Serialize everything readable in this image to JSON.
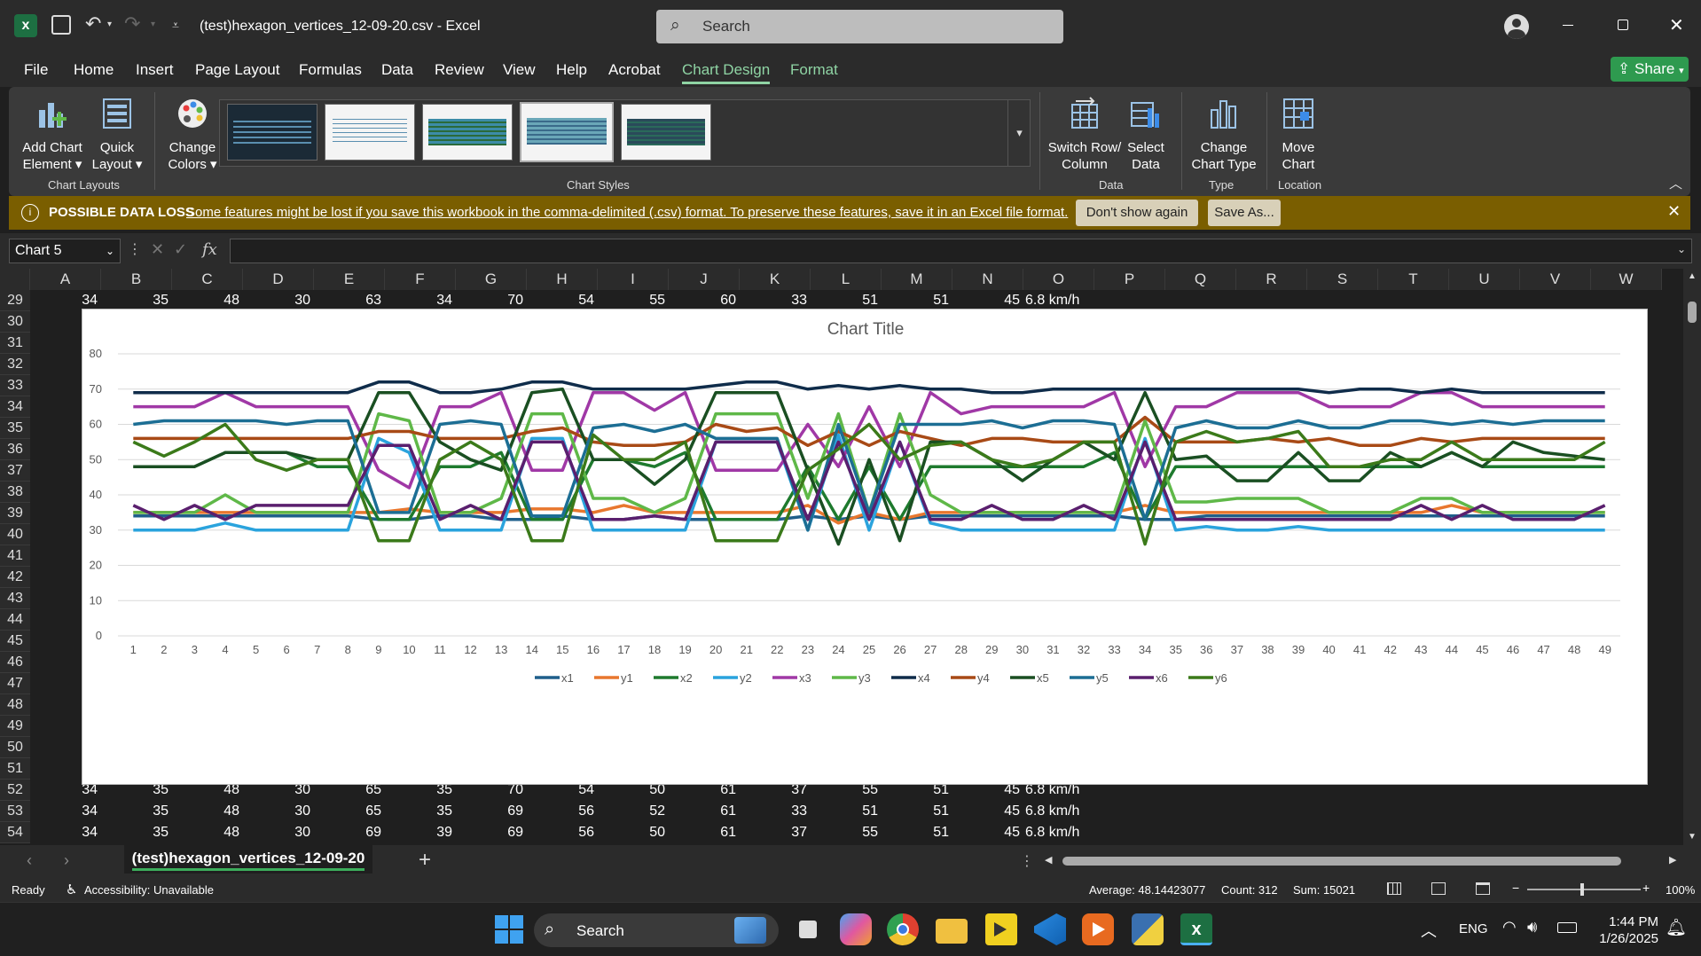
{
  "titlebar": {
    "filename": "(test)hexagon_vertices_12-09-20.csv",
    "app": "Excel",
    "separator": "-",
    "search_placeholder": "Search"
  },
  "menu": [
    "File",
    "Home",
    "Insert",
    "Page Layout",
    "Formulas",
    "Data",
    "Review",
    "View",
    "Help",
    "Acrobat",
    "Chart Design",
    "Format"
  ],
  "active_menu": "Chart Design",
  "share_label": "Share",
  "ribbon": {
    "add_chart_element": [
      "Add Chart",
      "Element"
    ],
    "quick_layout": [
      "Quick",
      "Layout"
    ],
    "change_colors": [
      "Change",
      "Colors"
    ],
    "switch_row_col": [
      "Switch Row/",
      "Column"
    ],
    "select_data": [
      "Select",
      "Data"
    ],
    "change_chart_type": [
      "Change",
      "Chart Type"
    ],
    "move_chart": [
      "Move",
      "Chart"
    ],
    "groups": {
      "chart_layouts": "Chart Layouts",
      "chart_styles": "Chart Styles",
      "data": "Data",
      "type": "Type",
      "location": "Location"
    }
  },
  "message_bar": {
    "title": "POSSIBLE DATA LOSS",
    "text": "Some features might be lost if you save this workbook in the comma-delimited (.csv) format. To preserve these features, save it in an Excel file format.",
    "dont_show": "Don't show again",
    "save_as": "Save As..."
  },
  "name_box": "Chart 5",
  "fx_label": "fx",
  "columns": [
    "A",
    "B",
    "C",
    "D",
    "E",
    "F",
    "G",
    "H",
    "I",
    "J",
    "K",
    "L",
    "M",
    "N",
    "O",
    "P",
    "Q",
    "R",
    "S",
    "T",
    "U",
    "V",
    "W"
  ],
  "rows": {
    "r29": {
      "num": "29",
      "cells": [
        "34",
        "35",
        "48",
        "30",
        "63",
        "34",
        "70",
        "54",
        "55",
        "60",
        "33",
        "51",
        "51",
        "45",
        "6.8 km/h"
      ]
    },
    "hidden_rows": [
      "30",
      "31",
      "32",
      "33",
      "34",
      "35",
      "36",
      "37",
      "38",
      "39",
      "40",
      "41",
      "42",
      "43",
      "44",
      "45",
      "46",
      "47",
      "48",
      "49",
      "50",
      "51"
    ],
    "r52": {
      "num": "52",
      "cells": [
        "34",
        "35",
        "48",
        "30",
        "65",
        "35",
        "70",
        "54",
        "50",
        "61",
        "37",
        "55",
        "51",
        "45",
        "6.8 km/h"
      ]
    },
    "r53": {
      "num": "53",
      "cells": [
        "34",
        "35",
        "48",
        "30",
        "65",
        "35",
        "69",
        "56",
        "52",
        "61",
        "33",
        "51",
        "51",
        "45",
        "6.8 km/h"
      ]
    },
    "r54": {
      "num": "54",
      "cells": [
        "34",
        "35",
        "48",
        "30",
        "69",
        "39",
        "69",
        "56",
        "50",
        "61",
        "37",
        "55",
        "51",
        "45",
        "6.8 km/h"
      ]
    }
  },
  "sheet_tab": "(test)hexagon_vertices_12-09-20",
  "status": {
    "ready": "Ready",
    "accessibility": "Accessibility: Unavailable",
    "average": "Average: 48.14423077",
    "count": "Count: 312",
    "sum": "Sum: 15021",
    "zoom": "100%"
  },
  "taskbar": {
    "search": "Search",
    "lang": "ENG",
    "time": "1:44 PM",
    "date": "1/26/2025"
  },
  "chart_data": {
    "type": "line",
    "title": "Chart Title",
    "ylim": [
      0,
      80
    ],
    "yticks": [
      0,
      10,
      20,
      30,
      40,
      50,
      60,
      70,
      80
    ],
    "x": [
      1,
      2,
      3,
      4,
      5,
      6,
      7,
      8,
      9,
      10,
      11,
      12,
      13,
      14,
      15,
      16,
      17,
      18,
      19,
      20,
      21,
      22,
      23,
      24,
      25,
      26,
      27,
      28,
      29,
      30,
      31,
      32,
      33,
      34,
      35,
      36,
      37,
      38,
      39,
      40,
      41,
      42,
      43,
      44,
      45,
      46,
      47,
      48,
      49
    ],
    "legend_position": "bottom",
    "series": [
      {
        "name": "x1",
        "color": "#1f5f8b",
        "values": [
          34,
          34,
          34,
          34,
          34,
          34,
          34,
          34,
          33,
          33,
          34,
          34,
          33,
          33,
          34,
          33,
          33,
          34,
          33,
          33,
          33,
          33,
          34,
          33,
          34,
          33,
          34,
          34,
          34,
          34,
          34,
          34,
          34,
          33,
          33,
          34,
          34,
          34,
          34,
          34,
          34,
          34,
          34,
          34,
          34,
          34,
          34,
          34,
          34
        ]
      },
      {
        "name": "y1",
        "color": "#e8772e",
        "values": [
          35,
          35,
          35,
          35,
          35,
          35,
          35,
          35,
          35,
          36,
          35,
          35,
          35,
          36,
          36,
          35,
          37,
          35,
          35,
          35,
          35,
          35,
          37,
          32,
          35,
          33,
          35,
          35,
          35,
          35,
          35,
          35,
          35,
          37,
          35,
          35,
          35,
          35,
          35,
          35,
          35,
          35,
          35,
          37,
          35,
          35,
          35,
          35,
          35
        ]
      },
      {
        "name": "x2",
        "color": "#1e7a2e",
        "values": [
          48,
          48,
          48,
          52,
          52,
          52,
          48,
          48,
          33,
          33,
          48,
          48,
          52,
          33,
          33,
          50,
          50,
          48,
          52,
          33,
          33,
          33,
          48,
          33,
          48,
          33,
          48,
          48,
          48,
          48,
          48,
          48,
          52,
          33,
          48,
          48,
          48,
          48,
          48,
          48,
          48,
          48,
          48,
          52,
          48,
          48,
          48,
          48,
          48
        ]
      },
      {
        "name": "y2",
        "color": "#2aa3dd",
        "values": [
          30,
          30,
          30,
          32,
          30,
          30,
          30,
          30,
          56,
          52,
          30,
          30,
          30,
          56,
          56,
          30,
          30,
          30,
          30,
          55,
          55,
          55,
          30,
          57,
          30,
          55,
          32,
          30,
          30,
          30,
          30,
          30,
          30,
          56,
          30,
          31,
          30,
          30,
          31,
          30,
          30,
          30,
          30,
          30,
          30,
          30,
          30,
          30,
          30
        ]
      },
      {
        "name": "x3",
        "color": "#a038a6",
        "values": [
          65,
          65,
          65,
          69,
          65,
          65,
          65,
          65,
          47,
          42,
          65,
          65,
          69,
          47,
          47,
          69,
          69,
          64,
          69,
          47,
          47,
          47,
          60,
          48,
          65,
          48,
          69,
          63,
          65,
          65,
          65,
          65,
          69,
          48,
          65,
          65,
          69,
          69,
          69,
          65,
          65,
          65,
          69,
          69,
          65,
          65,
          65,
          65,
          65
        ]
      },
      {
        "name": "y3",
        "color": "#5fb848",
        "values": [
          35,
          35,
          35,
          40,
          35,
          35,
          35,
          35,
          63,
          61,
          35,
          35,
          39,
          63,
          63,
          39,
          39,
          35,
          39,
          63,
          63,
          63,
          39,
          63,
          35,
          63,
          40,
          35,
          35,
          35,
          35,
          35,
          35,
          61,
          38,
          38,
          39,
          39,
          39,
          35,
          35,
          35,
          39,
          39,
          35,
          35,
          35,
          35,
          35
        ]
      },
      {
        "name": "x4",
        "color": "#0f2c4a",
        "values": [
          69,
          69,
          69,
          69,
          69,
          69,
          69,
          69,
          72,
          72,
          69,
          69,
          70,
          72,
          72,
          70,
          70,
          70,
          70,
          71,
          72,
          72,
          70,
          71,
          70,
          71,
          70,
          70,
          69,
          69,
          70,
          70,
          70,
          70,
          70,
          70,
          70,
          70,
          70,
          69,
          70,
          70,
          69,
          70,
          69,
          69,
          69,
          69,
          69
        ]
      },
      {
        "name": "y4",
        "color": "#a84a16",
        "values": [
          56,
          56,
          56,
          56,
          56,
          56,
          56,
          56,
          58,
          58,
          56,
          56,
          56,
          58,
          59,
          55,
          54,
          54,
          55,
          60,
          58,
          59,
          54,
          58,
          54,
          58,
          56,
          54,
          56,
          56,
          55,
          55,
          55,
          62,
          55,
          55,
          55,
          56,
          55,
          56,
          54,
          54,
          56,
          55,
          56,
          56,
          56,
          56,
          56
        ]
      },
      {
        "name": "x5",
        "color": "#1a4f22",
        "values": [
          48,
          48,
          48,
          52,
          52,
          52,
          50,
          50,
          69,
          69,
          55,
          50,
          47,
          69,
          70,
          50,
          50,
          43,
          50,
          69,
          69,
          69,
          47,
          26,
          50,
          27,
          55,
          55,
          50,
          44,
          50,
          55,
          50,
          69,
          50,
          51,
          44,
          44,
          52,
          44,
          44,
          52,
          48,
          52,
          48,
          55,
          52,
          51,
          50
        ]
      },
      {
        "name": "y5",
        "color": "#1c6e94",
        "values": [
          60,
          61,
          61,
          61,
          61,
          60,
          61,
          61,
          35,
          35,
          60,
          61,
          60,
          34,
          34,
          59,
          60,
          58,
          60,
          56,
          56,
          56,
          30,
          60,
          35,
          60,
          60,
          60,
          61,
          59,
          61,
          61,
          60,
          33,
          59,
          61,
          59,
          59,
          61,
          59,
          59,
          61,
          61,
          60,
          61,
          60,
          61,
          61,
          61
        ]
      },
      {
        "name": "x6",
        "color": "#5a1f6e",
        "values": [
          37,
          33,
          37,
          33,
          37,
          37,
          37,
          37,
          54,
          54,
          33,
          37,
          33,
          55,
          55,
          33,
          33,
          34,
          33,
          55,
          55,
          55,
          33,
          55,
          33,
          55,
          33,
          33,
          37,
          33,
          33,
          37,
          33,
          55,
          33,
          33,
          33,
          33,
          33,
          33,
          33,
          33,
          37,
          33,
          37,
          33,
          33,
          33,
          37
        ]
      },
      {
        "name": "y6",
        "color": "#3b7a1a",
        "values": [
          55,
          51,
          55,
          60,
          50,
          47,
          50,
          50,
          27,
          27,
          50,
          55,
          50,
          27,
          27,
          57,
          50,
          50,
          55,
          27,
          27,
          27,
          47,
          53,
          60,
          50,
          54,
          55,
          50,
          48,
          50,
          55,
          55,
          26,
          55,
          58,
          55,
          56,
          58,
          48,
          48,
          50,
          50,
          55,
          50,
          50,
          50,
          50,
          55
        ]
      }
    ]
  }
}
